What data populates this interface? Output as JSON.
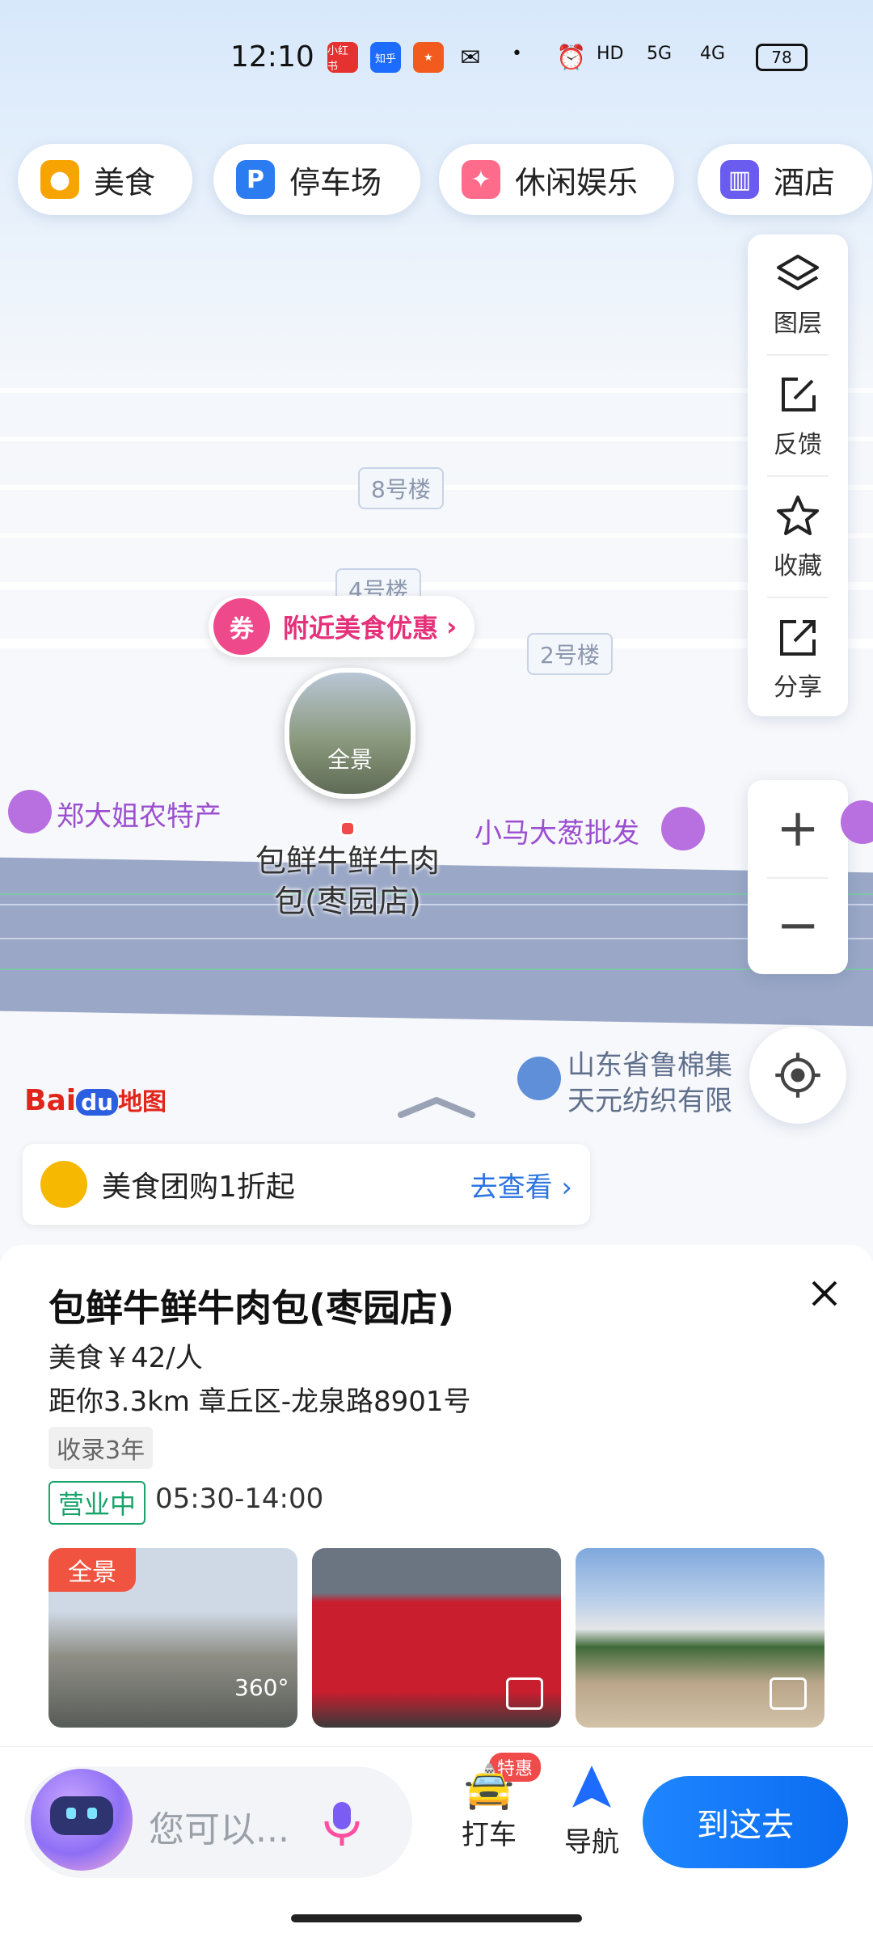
{
  "status_bar": {
    "time": "12:10",
    "app_badges": [
      "小红书",
      "知乎"
    ],
    "network": [
      "HD",
      "5G",
      "4G"
    ],
    "battery": "78"
  },
  "categories": [
    {
      "label": "美食",
      "icon": "food-icon",
      "color": "#f7a400"
    },
    {
      "label": "停车场",
      "icon": "parking-icon",
      "color": "#2b7cf0"
    },
    {
      "label": "休闲娱乐",
      "icon": "game-icon",
      "color": "#ff6b8a"
    },
    {
      "label": "酒店",
      "icon": "hotel-icon",
      "color": "#6b5cf0"
    }
  ],
  "map_tools": {
    "layers": "图层",
    "feedback": "反馈",
    "favorite": "收藏",
    "share": "分享"
  },
  "map": {
    "buildings": [
      "8号楼",
      "4号楼",
      "2号楼"
    ],
    "promo": "附近美食优惠",
    "panorama_label": "全景",
    "poi_left": "郑大姐农特产",
    "poi_right": "小马大葱批发",
    "poi_name_line1": "包鲜牛鲜牛肉",
    "poi_name_line2": "包(枣园店)",
    "poi_bottom_line1": "山东省鲁棉集",
    "poi_bottom_line2": "天元纺织有限",
    "logo_bai": "Bai",
    "logo_du": "du",
    "logo_map": "地图"
  },
  "coupon": {
    "text": "美食团购1折起",
    "link": "去查看"
  },
  "place": {
    "title": "包鲜牛鲜牛肉包(枣园店)",
    "category_price": "美食￥42/人",
    "distance_address": "距你3.3km  章丘区-龙泉路8901号",
    "tag": "收录3年",
    "status": "营业中",
    "hours": "05:30-14:00",
    "photo_badge": "全景",
    "photo_360": "360°"
  },
  "bottom_bar": {
    "assistant_placeholder": "您可以...",
    "taxi": "打车",
    "taxi_badge": "特惠",
    "navigate": "导航",
    "go_here": "到这去"
  },
  "colors": {
    "accent_blue": "#1e86ff",
    "promo_pink": "#e5317a",
    "open_green": "#1aa36a"
  }
}
